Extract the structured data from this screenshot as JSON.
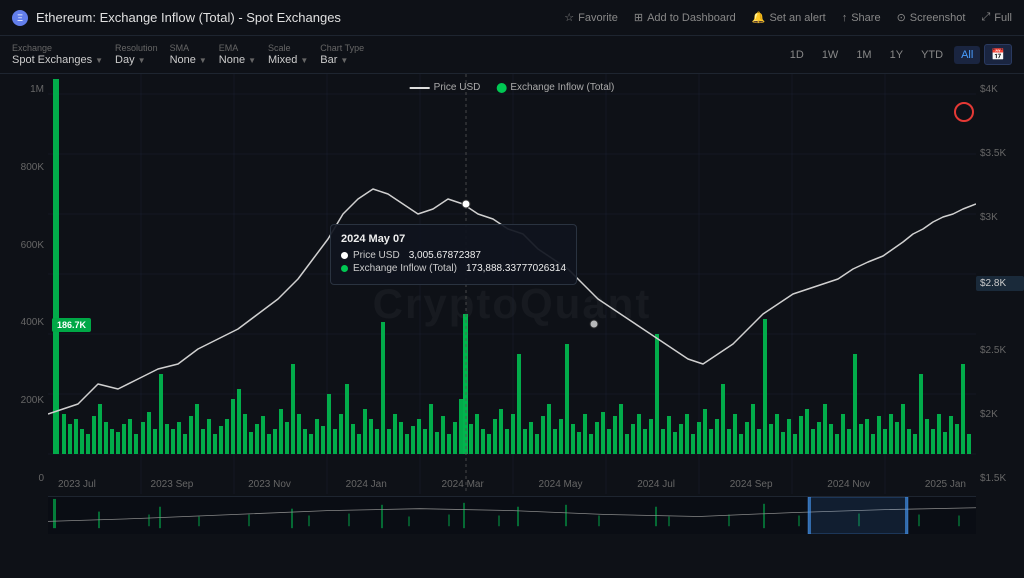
{
  "header": {
    "title": "Ethereum: Exchange Inflow (Total) - Spot Exchanges",
    "eth_symbol": "Ξ",
    "actions": [
      {
        "label": "Favorite",
        "icon": "star-icon"
      },
      {
        "label": "Add to Dashboard",
        "icon": "dashboard-icon"
      },
      {
        "label": "Set an alert",
        "icon": "bell-icon"
      },
      {
        "label": "Share",
        "icon": "share-icon"
      },
      {
        "label": "Screenshot",
        "icon": "camera-icon"
      },
      {
        "label": "Full",
        "icon": "expand-icon"
      }
    ]
  },
  "toolbar": {
    "groups": [
      {
        "label": "Exchange",
        "value": "Spot Exchanges",
        "has_dropdown": true
      },
      {
        "label": "Resolution",
        "value": "Day",
        "has_dropdown": true
      },
      {
        "label": "SMA",
        "value": "None",
        "has_dropdown": true
      },
      {
        "label": "EMA",
        "value": "None",
        "has_dropdown": true
      },
      {
        "label": "Scale",
        "value": "Mixed",
        "has_dropdown": true
      },
      {
        "label": "Chart Type",
        "value": "Bar",
        "has_dropdown": true
      }
    ],
    "time_buttons": [
      "1D",
      "1W",
      "1M",
      "1Y",
      "YTD",
      "All"
    ],
    "active_time": "All",
    "calendar_icon": "📅"
  },
  "legend": {
    "price_label": "Price USD",
    "inflow_label": "Exchange Inflow (Total)"
  },
  "y_axis_left": {
    "labels": [
      "1M",
      "800K",
      "600K",
      "400K",
      "200K",
      "0"
    ]
  },
  "y_axis_right": {
    "labels": [
      "$4K",
      "$3.5K",
      "$3K",
      "$2.8K",
      "$2.5K",
      "$2K",
      "$1.5K"
    ]
  },
  "x_axis": {
    "labels": [
      "2023 Jul",
      "2023 Sep",
      "2023 Nov",
      "2024 Jan",
      "2024 Mar",
      "2024 May",
      "2024 Jul",
      "2024 Sep",
      "2024 Nov",
      "2025 Jan"
    ]
  },
  "inflow_badge": "186.7K",
  "highlighted_price": "$2.8K",
  "tooltip": {
    "date": "2024 May 07",
    "price_label": "Price USD",
    "price_value": "3,005.67872387",
    "inflow_label": "Exchange Inflow (Total)",
    "inflow_value": "173,888.33777026314"
  },
  "watermark": "CryptoQuant",
  "colors": {
    "background": "#0e1117",
    "bar_fill": "#00c853",
    "price_line": "#e0e0e0",
    "accent": "#4a9eff",
    "alert_red": "#e53935"
  }
}
